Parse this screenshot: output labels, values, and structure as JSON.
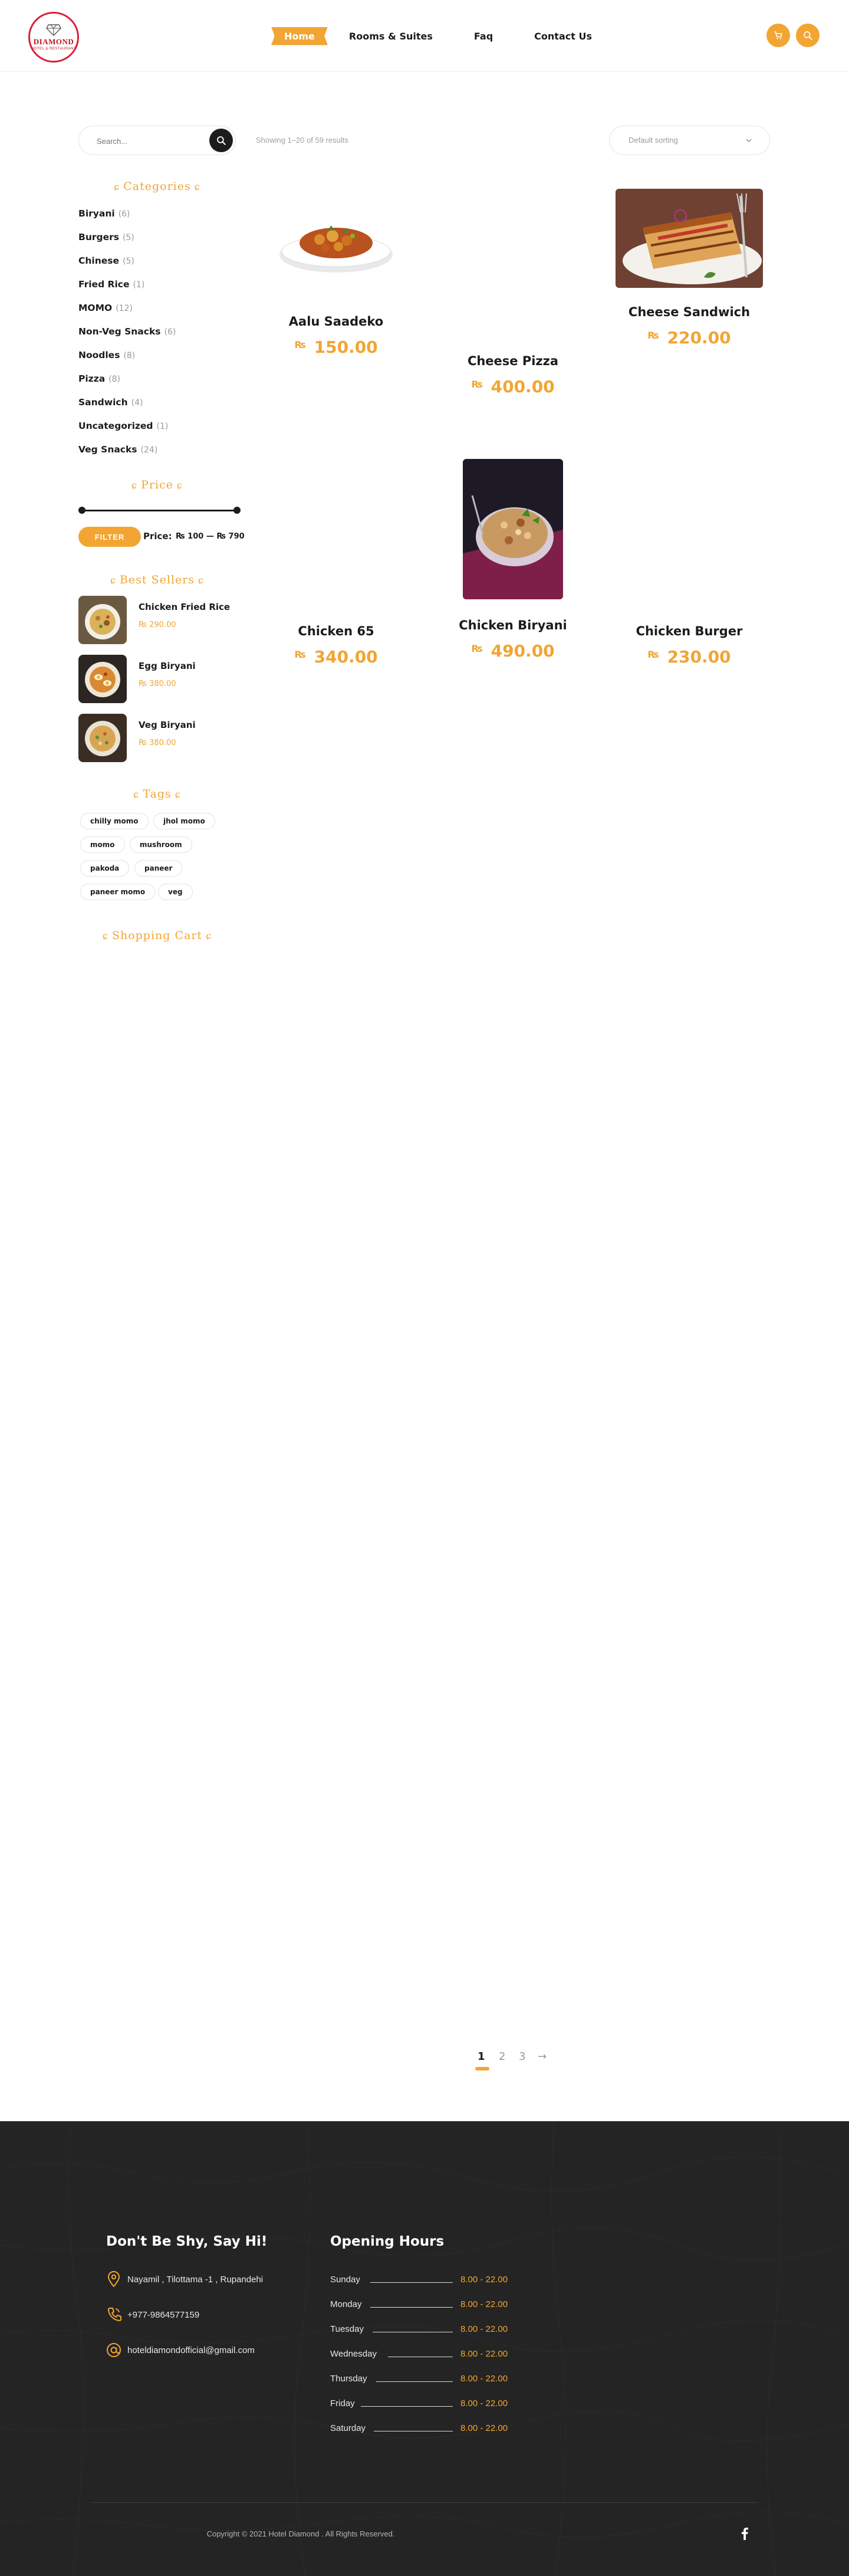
{
  "header": {
    "logo_text": "DIAMOND",
    "logo_sub": "HOTEL & RESTAURANT",
    "nav": [
      {
        "label": "Home",
        "active": true
      },
      {
        "label": "Rooms & Suites",
        "active": false
      },
      {
        "label": "Faq",
        "active": false
      },
      {
        "label": "Contact Us",
        "active": false
      }
    ],
    "cart_icon": "cart-icon",
    "search_icon": "search-icon",
    "accent_color": "#f2a532"
  },
  "sidebar": {
    "search_placeholder": "Search...",
    "categories_title": "Categories",
    "categories": [
      {
        "name": "Biryani",
        "count": "(6)"
      },
      {
        "name": "Burgers",
        "count": "(5)"
      },
      {
        "name": "Chinese",
        "count": "(5)"
      },
      {
        "name": "Fried Rice",
        "count": "(1)"
      },
      {
        "name": "MOMO",
        "count": "(12)"
      },
      {
        "name": "Non-Veg Snacks",
        "count": "(6)"
      },
      {
        "name": "Noodles",
        "count": "(8)"
      },
      {
        "name": "Pizza",
        "count": "(8)"
      },
      {
        "name": "Sandwich",
        "count": "(4)"
      },
      {
        "name": "Uncategorized",
        "count": "(1)"
      },
      {
        "name": "Veg Snacks",
        "count": "(24)"
      }
    ],
    "price_title": "Price",
    "filter_label": "FILTER",
    "price_label": "Price:",
    "price_range": "₨ 100 — ₨ 790",
    "best_sellers_title": "Best Sellers",
    "best_sellers": [
      {
        "name": "Chicken Fried Rice",
        "price": "₨ 290.00"
      },
      {
        "name": "Egg Biryani",
        "price": "₨ 380.00"
      },
      {
        "name": "Veg Biryani",
        "price": "₨ 380.00"
      }
    ],
    "tags_title": "Tags",
    "tags": [
      "chilly momo",
      "jhol momo",
      "momo",
      "mushroom",
      "pakoda",
      "paneer",
      "paneer momo",
      "veg"
    ],
    "cart_title": "Shopping Cart"
  },
  "shop": {
    "results_text": "Showing 1–20 of 59 results",
    "sort_label": "Default sorting",
    "products": [
      {
        "name": "Aalu Saadeko",
        "currency": "₨",
        "price": "150.00"
      },
      {
        "name": "Cheese Pizza",
        "currency": "₨",
        "price": "400.00"
      },
      {
        "name": "Cheese Sandwich",
        "currency": "₨",
        "price": "220.00"
      },
      {
        "name": "Chicken 65",
        "currency": "₨",
        "price": "340.00"
      },
      {
        "name": "Chicken Biryani",
        "currency": "₨",
        "price": "490.00"
      },
      {
        "name": "Chicken Burger",
        "currency": "₨",
        "price": "230.00"
      }
    ],
    "pagination": {
      "pages": [
        "1",
        "2",
        "3"
      ],
      "current": "1",
      "next": "→"
    }
  },
  "footer": {
    "contact_title": "Don't Be Shy, Say Hi!",
    "address": "Nayamil , Tilottama -1 , Rupandehi",
    "phone": "+977-9864577159",
    "email": "hoteldiamondofficial@gmail.com",
    "hours_title": "Opening Hours",
    "hours": [
      {
        "day": "Sunday",
        "time": "8.00 - 22.00"
      },
      {
        "day": "Monday",
        "time": "8.00 - 22.00"
      },
      {
        "day": "Tuesday",
        "time": "8.00 - 22.00"
      },
      {
        "day": "Wednesday",
        "time": "8.00 - 22.00"
      },
      {
        "day": "Thursday",
        "time": "8.00 - 22.00"
      },
      {
        "day": "Friday",
        "time": "8.00 - 22.00"
      },
      {
        "day": "Saturday",
        "time": "8.00 - 22.00"
      }
    ],
    "copyright": "Copyright © 2021 Hotel Diamond . All Rights Reserved.",
    "social_icon": "facebook-icon"
  }
}
